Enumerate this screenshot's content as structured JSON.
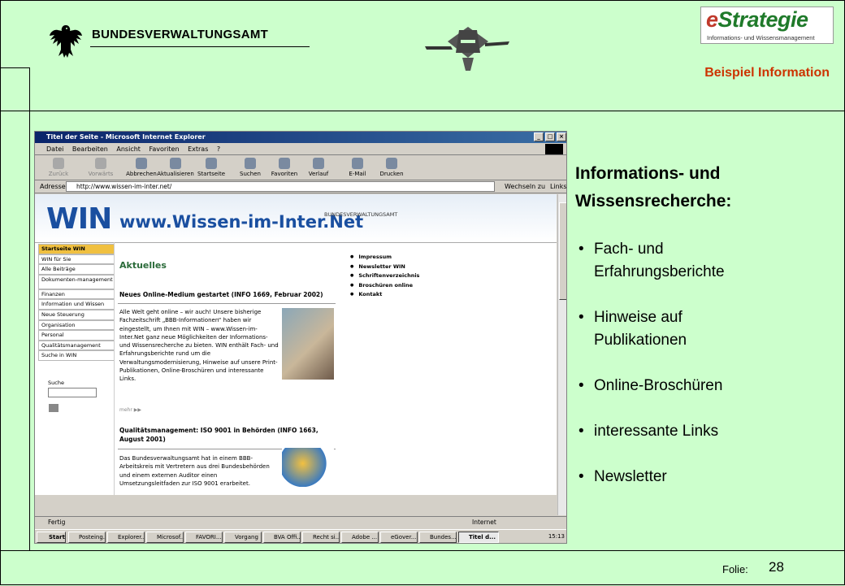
{
  "header": {
    "org": "BUNDESVERWALTUNGSAMT",
    "subtitle": "Beispiel Information",
    "brand_logo_text": {
      "e": "e",
      "rest": "Strategie",
      "tagline": "Informations- und Wissensmanagement"
    }
  },
  "footer": {
    "label": "Folie:",
    "number": "28"
  },
  "content": {
    "title_line1": "Informations- und",
    "title_line2": "Wissensrecherche:",
    "bullets": [
      {
        "line1": "Fach- und",
        "line2": "Erfahrungsberichte"
      },
      {
        "line1": "Hinweise auf",
        "line2": "Publikationen"
      },
      {
        "line1": "Online-Broschüren",
        "line2": ""
      },
      {
        "line1": "interessante Links",
        "line2": ""
      },
      {
        "line1": "Newsletter",
        "line2": ""
      }
    ]
  },
  "browser": {
    "title": "Titel der Seite - Microsoft Internet Explorer",
    "window_buttons": [
      "_",
      "□",
      "×"
    ],
    "menu": [
      "Datei",
      "Bearbeiten",
      "Ansicht",
      "Favoriten",
      "Extras",
      "?"
    ],
    "toolbar": [
      {
        "label": "Zurück",
        "icon": "back-arrow-icon",
        "disabled": true
      },
      {
        "label": "Vorwärts",
        "icon": "forward-arrow-icon",
        "disabled": true
      },
      {
        "label": "Abbrechen",
        "icon": "stop-icon",
        "disabled": false
      },
      {
        "label": "Aktualisieren",
        "icon": "refresh-icon",
        "disabled": false
      },
      {
        "label": "Startseite",
        "icon": "home-icon",
        "disabled": false
      },
      {
        "label": "Suchen",
        "icon": "search-icon",
        "disabled": false
      },
      {
        "label": "Favoriten",
        "icon": "favorites-icon",
        "disabled": false
      },
      {
        "label": "Verlauf",
        "icon": "history-icon",
        "disabled": false
      },
      {
        "label": "E-Mail",
        "icon": "mail-icon",
        "disabled": false
      },
      {
        "label": "Drucken",
        "icon": "print-icon",
        "disabled": false
      }
    ],
    "address_label": "Adresse",
    "address": "http://www.wissen-im-inter.net/",
    "go_label": "Wechseln zu",
    "links_label": "Links",
    "status_left": "Fertig",
    "status_zone": "Internet"
  },
  "webpage": {
    "logo": "WIN",
    "logo_url": "www.Wissen-im-Inter.Net",
    "org": "BUNDESVERWALTUNGSAMT",
    "nav": [
      "Startseite WIN",
      "WIN für Sie",
      "Alle Beiträge",
      "Dokumenten-management",
      "Finanzen",
      "Information und Wissen",
      "Neue Steuerung",
      "Organisation",
      "Personal",
      "Qualitätsmanagement",
      "Suche in WIN"
    ],
    "search_label": "Suche",
    "section_title": "Aktuelles",
    "news1_title": "Neues Online-Medium gestartet (INFO 1669, Februar 2002)",
    "news1_body": "Alle Welt geht online – wir auch! Unsere bisherige Fachzeitschrift „BBB-Informationen“ haben wir eingestellt, um Ihnen mit WIN – www.Wissen-im-Inter.Net ganz neue Möglichkeiten der Informations- und Wissensrecherche zu bieten. WIN enthält Fach- und Erfahrungsberichte rund um die Verwaltungsmodernisierung, Hinweise auf unsere Print-Publikationen, Online-Broschüren und interessante Links.",
    "more_label": "mehr ▶▶",
    "news2_title": "Qualitätsmanagement: ISO 9001 in Behörden (INFO 1663, August 2001)",
    "news2_body": "Das Bundesverwaltungsamt hat in einem BBB-Arbeitskreis mit Vertretern aus drei Bundesbehörden und einem externen Auditor einen Umsetzungsleitfaden zur ISO 9001 erarbeitet.",
    "links": [
      "Impressum",
      "Newsletter WIN",
      "Schriftenverzeichnis",
      "Broschüren online",
      "Kontakt"
    ]
  },
  "taskbar": {
    "start": "Start",
    "items": [
      "Posteing...",
      "Explorer...",
      "Microsof...",
      "FAVORI...",
      "Vorgang",
      "BVA Offi...",
      "Recht si...",
      "Adobe ...",
      "eGover...",
      "Bundes...",
      "Titel d..."
    ],
    "active_index": 10,
    "clock": "15:13"
  }
}
